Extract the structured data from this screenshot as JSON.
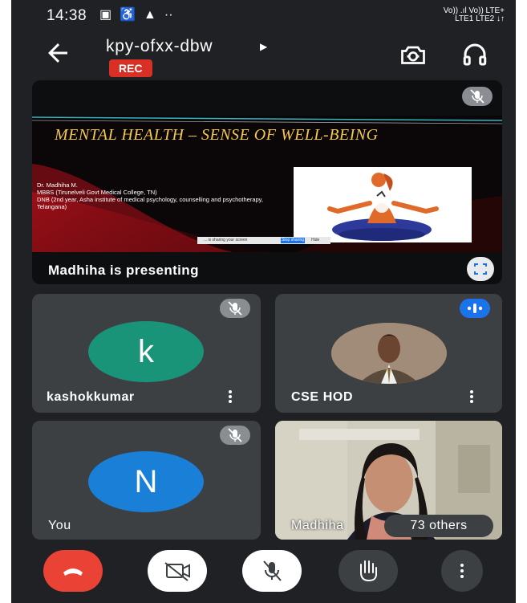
{
  "status_bar": {
    "time": "14:38",
    "network_line1": "Vo)) .ıl Vo)) LTE+",
    "network_line2": "LTE1   LTE2 ↓↑"
  },
  "meeting": {
    "code": "kpy-ofxx-dbw",
    "rec_label": "REC"
  },
  "presentation": {
    "slide_title": "MENTAL HEALTH – SENSE OF WELL-BEING",
    "slide_author": "Dr. Madhiha M.",
    "slide_line1": "MBBS (Tirunelveli Govt Medical College, TN)",
    "slide_line2": "DNB (2nd year, Asha institute of medical psychology, counselling and psychotherapy, Telangana)",
    "share_bar_text": "... is sharing your screen",
    "share_bar_button": "Stop sharing",
    "share_bar_hide": "Hide",
    "label": "Madhiha is presenting"
  },
  "participants": [
    {
      "initial": "k",
      "name": "kashokkumar",
      "avatar_color": "#1a9478"
    },
    {
      "name": "CSE HOD",
      "speaking": true
    },
    {
      "initial": "N",
      "name": "You",
      "avatar_color": "#1a7fd6"
    },
    {
      "name": "Madhiha",
      "others_label": "73 others"
    }
  ],
  "colors": {
    "background": "#202124",
    "tile": "#3c4043",
    "end_call": "#ea4335",
    "speaking": "#1a73e8"
  }
}
